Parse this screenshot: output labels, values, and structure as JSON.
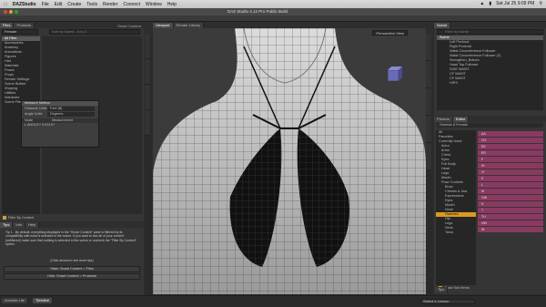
{
  "menubar": {
    "app": "DAZStudio",
    "items": [
      "File",
      "Edit",
      "Create",
      "Tools",
      "Render",
      "Connect",
      "Window",
      "Help"
    ],
    "clock": "Sat Jul 25  9:09 PM"
  },
  "window": {
    "title": "DAZ Studio 4.12 Pro Public Build"
  },
  "left_panel": {
    "tabs": [
      "Files",
      "Products"
    ],
    "header_tab": "Smart Content",
    "filter_label": "Female",
    "search_placeholder": "Sort by Name - A to Z",
    "categories": [
      "All Files",
      "Accessories",
      "Anatomy",
      "Animations",
      "Figures",
      "Hair",
      "Materials",
      "Poses",
      "Props",
      "Render Settings",
      "Scene Builder",
      "Shaping",
      "Utilities",
      "Wardrobe",
      "Scene Files"
    ],
    "filter_by_context": "Filter By Context",
    "tips_tabs": [
      "Tips",
      "Info",
      "Help"
    ],
    "tip_text": "Tip 1 - By default, everything displayed in the \"Smart Content\" pane is filtered by its compatibility with what is selected in the scene. If you want to see all of your content (unfiltered) make sure that nothing is selected in the scene or uncheck the \"Filter By Context\" option.",
    "click_text": "(Click arrows to see more tips)",
    "btn_content": "Stats: Smart Content > Files",
    "btn_products": "Hide: Smart Content > Products"
  },
  "measure_dialog": {
    "title": "Measure Metrics",
    "label_units": "Distance Units",
    "value_units": "Feet (ft)",
    "label_angle": "Angle Units",
    "value_angle": "Degrees",
    "col_node": "Node",
    "col_measurement": "Measurement",
    "row_text": "L ANGLE?  3.0X10?"
  },
  "viewport": {
    "tabs": [
      "Viewport",
      "Render Library"
    ],
    "view_label": "Perspective View"
  },
  "scene_panel": {
    "tabs": [
      "Scene"
    ],
    "search_placeholder": "Filter by Name",
    "items": [
      "Scene",
      "Left Pectoral",
      "Right Pectoral",
      "Waist Circumference Follower",
      "Waist Circumference Follower (2)",
      "Strengthen_Bottom",
      "Head Top Follower",
      "SIDE WAIST",
      "CF WAIST",
      "CF WAIST",
      "HIPS"
    ]
  },
  "params_panel": {
    "tabs": [
      "Params",
      "Editor"
    ],
    "figure_label": "Genesis 8 Female",
    "groups": [
      "All",
      "Favorites",
      "Currently Used"
    ],
    "tree": [
      "Actor",
      "Arms",
      "Chest",
      "Eyes",
      "Full Body",
      "Head",
      "Legs",
      "Mouth",
      "Pose Controls",
      "Brow",
      "Cheeks & Jaw",
      "Expressions",
      "Eyes",
      "Mouth",
      "Nose",
      "Visemes",
      "Hip",
      "Legs",
      "Neck",
      "Torso"
    ],
    "selected": "Visemes",
    "sliders": [
      "AA",
      "CH",
      "EE",
      "ER",
      "F",
      "IH",
      "IY",
      "K",
      "L",
      "M",
      "OW",
      "S",
      "T",
      "TH",
      "UW",
      "W"
    ],
    "show_sub": "Show Sub Items"
  },
  "bottom": {
    "tabs_left": [
      "Animate Lite",
      "Timeline"
    ],
    "tips_label": "Tips",
    "lesson_label": "Select a Lesson"
  },
  "colors": {
    "accent": "#8a3a60",
    "selection": "#d89a20",
    "mesh": "#c8c8c8"
  },
  "icons": [
    "apple-icon",
    "wifi-icon",
    "battery-icon",
    "search-icon"
  ]
}
